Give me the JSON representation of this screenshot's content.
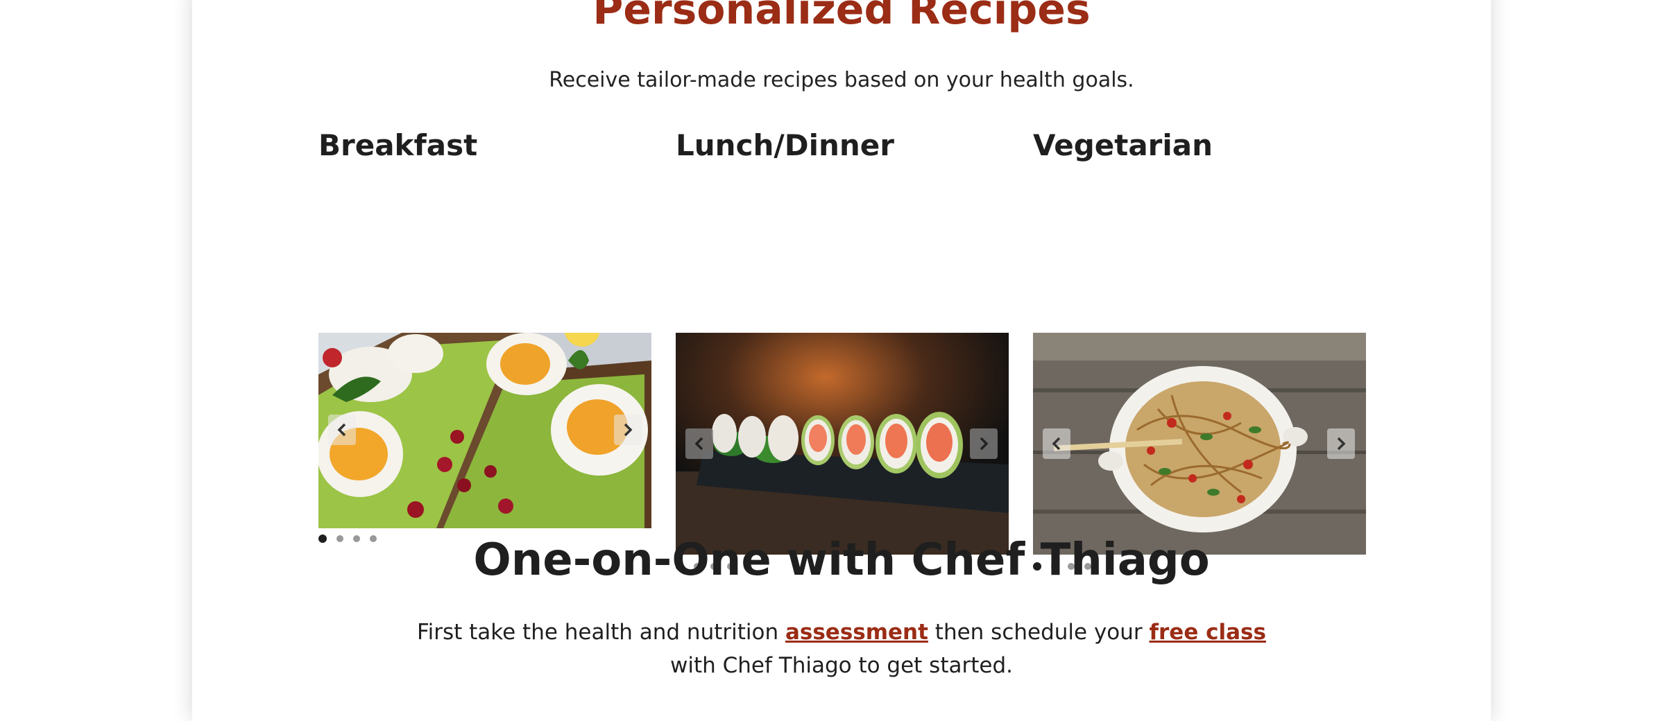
{
  "header": {
    "title": "Personalized Recipes",
    "subtitle": "Receive tailor-made recipes based on your health goals."
  },
  "categories": [
    {
      "title": "Breakfast",
      "slide_count": 4,
      "active_slide": 1,
      "image": "avocado-egg-toast-photo"
    },
    {
      "title": "Lunch/Dinner",
      "slide_count": 4,
      "active_slide": 1,
      "image": "salmon-sushi-rolls-photo"
    },
    {
      "title": "Vegetarian",
      "slide_count": 4,
      "active_slide": 1,
      "image": "vegetable-noodles-bowl-photo"
    }
  ],
  "icons": {
    "prev": "chevron-left-icon",
    "next": "chevron-right-icon"
  },
  "chef_section": {
    "title": "One-on-One with Chef Thiago",
    "text_before": "First take the health and nutrition ",
    "link1": "assessment",
    "text_middle": " then schedule your ",
    "link2": "free class",
    "text_after": "with Chef Thiago to get started."
  },
  "colors": {
    "accent": "#9b2c15",
    "text": "#1f1f1f"
  }
}
